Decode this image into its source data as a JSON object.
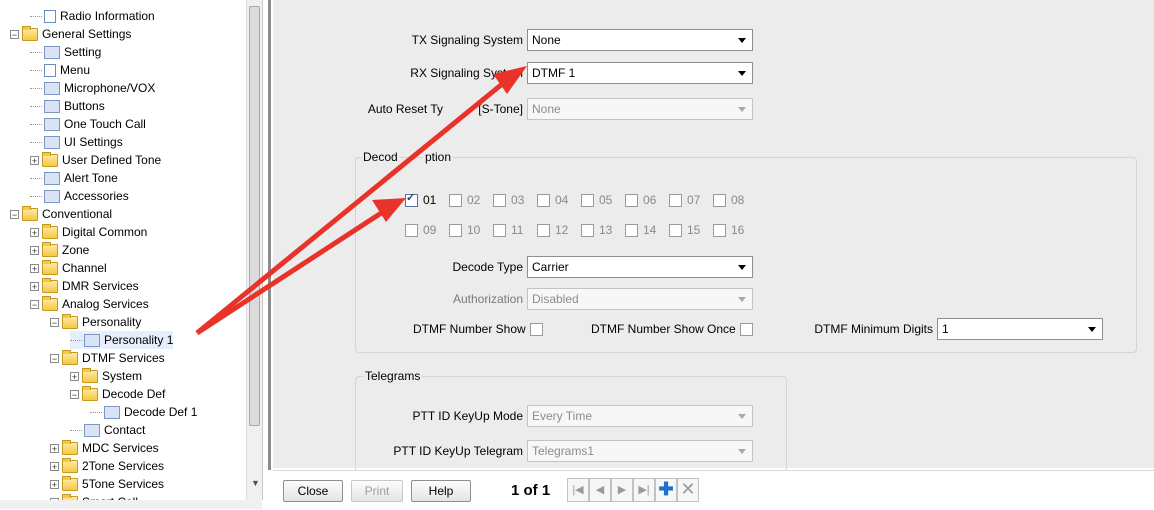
{
  "tree": {
    "items": [
      {
        "label": "Radio Information",
        "level": 1,
        "icon": "document-icon"
      },
      {
        "label": "General Settings",
        "level": 0,
        "icon": "folder-icon",
        "expanded": true
      },
      {
        "label": "Setting",
        "level": 1,
        "icon": "wrench-icon"
      },
      {
        "label": "Menu",
        "level": 1,
        "icon": "menu-icon"
      },
      {
        "label": "Microphone/VOX",
        "level": 1,
        "icon": "microphone-icon"
      },
      {
        "label": "Buttons",
        "level": 1,
        "icon": "button-cursor-icon"
      },
      {
        "label": "One Touch Call",
        "level": 1,
        "icon": "phone-icon"
      },
      {
        "label": "UI Settings",
        "level": 1,
        "icon": "ui-settings-icon"
      },
      {
        "label": "User Defined Tone",
        "level": 1,
        "icon": "folder-icon",
        "expanded": false
      },
      {
        "label": "Alert Tone",
        "level": 1,
        "icon": "alert-tone-icon"
      },
      {
        "label": "Accessories",
        "level": 1,
        "icon": "accessories-icon"
      },
      {
        "label": "Conventional",
        "level": 0,
        "icon": "folder-icon",
        "expanded": true
      },
      {
        "label": "Digital Common",
        "level": 1,
        "icon": "folder-icon",
        "expanded": false
      },
      {
        "label": "Zone",
        "level": 1,
        "icon": "folder-icon",
        "expanded": false
      },
      {
        "label": "Channel",
        "level": 1,
        "icon": "folder-icon",
        "expanded": false
      },
      {
        "label": "DMR Services",
        "level": 1,
        "icon": "folder-icon",
        "expanded": false
      },
      {
        "label": "Analog Services",
        "level": 1,
        "icon": "folder-icon",
        "expanded": true
      },
      {
        "label": "Personality",
        "level": 2,
        "icon": "folder-icon",
        "expanded": true
      },
      {
        "label": "Personality 1",
        "level": 3,
        "icon": "personality-icon",
        "selected": true
      },
      {
        "label": "DTMF Services",
        "level": 2,
        "icon": "folder-icon",
        "expanded": true
      },
      {
        "label": "System",
        "level": 3,
        "icon": "folder-icon",
        "expanded": false
      },
      {
        "label": "Decode Def",
        "level": 3,
        "icon": "folder-icon",
        "expanded": true
      },
      {
        "label": "Decode Def 1",
        "level": 4,
        "icon": "decode-def-icon"
      },
      {
        "label": "Contact",
        "level": 3,
        "icon": "contact-icon"
      },
      {
        "label": "MDC Services",
        "level": 2,
        "icon": "folder-icon",
        "expanded": false
      },
      {
        "label": "2Tone Services",
        "level": 2,
        "icon": "folder-icon",
        "expanded": false
      },
      {
        "label": "5Tone Services",
        "level": 2,
        "icon": "folder-icon",
        "expanded": false
      },
      {
        "label": "Smart Call",
        "level": 2,
        "icon": "folder-icon",
        "expanded": false
      }
    ]
  },
  "form": {
    "tx_signaling": {
      "label": "TX Signaling System",
      "value": "None"
    },
    "rx_signaling": {
      "label": "RX Signaling System",
      "value": "DTMF 1"
    },
    "auto_reset": {
      "label": "Auto Reset Type [S-Tone]",
      "label_visible_left": "Auto Reset Ty",
      "label_visible_right": "[S-Tone]",
      "value": "None"
    },
    "decode_option": {
      "title": "Decode Option",
      "title_left": "Decod",
      "title_right": "ption",
      "checks": [
        {
          "label": "01",
          "checked": true
        },
        {
          "label": "02",
          "checked": false
        },
        {
          "label": "03",
          "checked": false
        },
        {
          "label": "04",
          "checked": false
        },
        {
          "label": "05",
          "checked": false
        },
        {
          "label": "06",
          "checked": false
        },
        {
          "label": "07",
          "checked": false
        },
        {
          "label": "08",
          "checked": false
        },
        {
          "label": "09",
          "checked": false
        },
        {
          "label": "10",
          "checked": false
        },
        {
          "label": "11",
          "checked": false
        },
        {
          "label": "12",
          "checked": false
        },
        {
          "label": "13",
          "checked": false
        },
        {
          "label": "14",
          "checked": false
        },
        {
          "label": "15",
          "checked": false
        },
        {
          "label": "16",
          "checked": false
        }
      ],
      "decode_type": {
        "label": "Decode Type",
        "value": "Carrier"
      },
      "authorization": {
        "label": "Authorization",
        "value": "Disabled"
      },
      "dtmf_number_show": {
        "label": "DTMF Number Show",
        "checked": false
      },
      "dtmf_number_show_once": {
        "label": "DTMF Number Show Once",
        "checked": false
      },
      "dtmf_min_digits": {
        "label": "DTMF Minimum Digits",
        "value": "1"
      }
    },
    "telegrams": {
      "title": "Telegrams",
      "ptt_keyup_mode": {
        "label": "PTT ID KeyUp Mode",
        "value": "Every Time"
      },
      "ptt_keyup_telegram": {
        "label": "PTT ID KeyUp Telegram",
        "value": "Telegrams1"
      }
    }
  },
  "bottombar": {
    "close": "Close",
    "print": "Print",
    "help": "Help",
    "page": "1 of 1",
    "nav_icons": [
      "first-page-icon",
      "prev-page-icon",
      "next-page-icon",
      "last-page-icon",
      "add-icon",
      "delete-icon"
    ]
  },
  "colors": {
    "arrow": "#e8332a",
    "page_text": "#1f3b8f",
    "panel_bg": "#ececec"
  }
}
